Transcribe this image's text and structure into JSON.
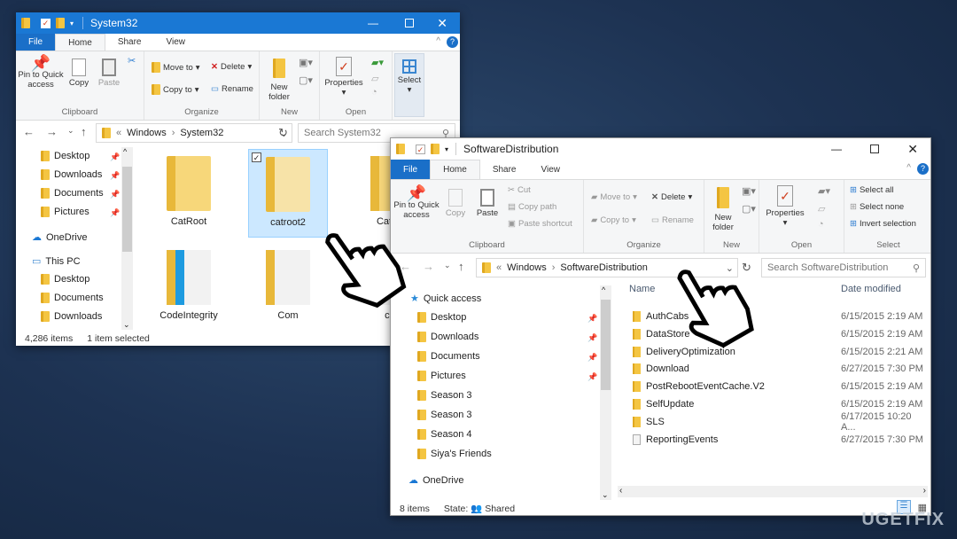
{
  "colors": {
    "accent": "#1a6fc8",
    "titlebar_system32": "#1a78d4",
    "selection": "#cce8ff",
    "folder": "#f4c542"
  },
  "win1": {
    "title": "System32",
    "tabs": [
      "File",
      "Home",
      "Share",
      "View"
    ],
    "ribbon": {
      "pin": "Pin to Quick access",
      "copy": "Copy",
      "paste": "Paste",
      "clipboard": "Clipboard",
      "move_to": "Move to",
      "copy_to": "Copy to",
      "delete": "Delete",
      "rename": "Rename",
      "organize": "Organize",
      "new_folder": "New folder",
      "new": "New",
      "properties": "Properties",
      "open": "Open",
      "select": "Select"
    },
    "address": {
      "root": "«",
      "parts": [
        "Windows",
        "System32"
      ],
      "search_placeholder": "Search System32"
    },
    "nav": [
      {
        "label": "Desktop",
        "pinned": true
      },
      {
        "label": "Downloads",
        "pinned": true
      },
      {
        "label": "Documents",
        "pinned": true
      },
      {
        "label": "Pictures",
        "pinned": true
      },
      {
        "label": "OneDrive",
        "icon": "cloud-icon"
      },
      {
        "label": "This PC",
        "icon": "computer-icon"
      },
      {
        "label": "Desktop"
      },
      {
        "label": "Documents"
      },
      {
        "label": "Downloads"
      }
    ],
    "items": [
      {
        "name": "CatRoot"
      },
      {
        "name": "catroot2",
        "selected": true
      },
      {
        "name": "Catroot"
      },
      {
        "name": "CodeIntegrity"
      },
      {
        "name": "Com"
      },
      {
        "name": "con"
      }
    ],
    "status": {
      "count": "4,286 items",
      "selected": "1 item selected"
    }
  },
  "win2": {
    "title": "SoftwareDistribution",
    "tabs": [
      "File",
      "Home",
      "Share",
      "View"
    ],
    "ribbon": {
      "pin": "Pin to Quick access",
      "copy": "Copy",
      "paste": "Paste",
      "cut": "Cut",
      "copy_path": "Copy path",
      "paste_shortcut": "Paste shortcut",
      "clipboard": "Clipboard",
      "move_to": "Move to",
      "copy_to": "Copy to",
      "delete": "Delete",
      "rename": "Rename",
      "organize": "Organize",
      "new_folder": "New folder",
      "new": "New",
      "properties": "Properties",
      "open": "Open",
      "select_all": "Select all",
      "select_none": "Select none",
      "invert_selection": "Invert selection",
      "select": "Select"
    },
    "address": {
      "root": "«",
      "parts": [
        "Windows",
        "SoftwareDistribution"
      ],
      "search_placeholder": "Search SoftwareDistribution"
    },
    "nav": [
      {
        "label": "Quick access",
        "icon": "star-icon"
      },
      {
        "label": "Desktop",
        "pinned": true
      },
      {
        "label": "Downloads",
        "pinned": true
      },
      {
        "label": "Documents",
        "pinned": true
      },
      {
        "label": "Pictures",
        "pinned": true
      },
      {
        "label": "Season 3"
      },
      {
        "label": "Season 3"
      },
      {
        "label": "Season 4"
      },
      {
        "label": "Siya's Friends"
      },
      {
        "label": "OneDrive",
        "icon": "cloud-icon"
      }
    ],
    "columns": {
      "name": "Name",
      "date": "Date modified"
    },
    "files": [
      {
        "name": "AuthCabs",
        "date": "6/15/2015 2:19 AM",
        "type": "folder"
      },
      {
        "name": "DataStore",
        "date": "6/15/2015 2:19 AM",
        "type": "folder"
      },
      {
        "name": "DeliveryOptimization",
        "date": "6/15/2015 2:21 AM",
        "type": "folder"
      },
      {
        "name": "Download",
        "date": "6/27/2015 7:30 PM",
        "type": "folder"
      },
      {
        "name": "PostRebootEventCache.V2",
        "date": "6/15/2015 2:19 AM",
        "type": "folder"
      },
      {
        "name": "SelfUpdate",
        "date": "6/15/2015 2:19 AM",
        "type": "folder"
      },
      {
        "name": "SLS",
        "date": "6/17/2015 10:20 A...",
        "type": "folder"
      },
      {
        "name": "ReportingEvents",
        "date": "6/27/2015 7:30 PM",
        "type": "file"
      }
    ],
    "status": {
      "count": "8 items",
      "state_label": "State:",
      "state": "Shared"
    }
  },
  "watermark": "UGETFIX"
}
